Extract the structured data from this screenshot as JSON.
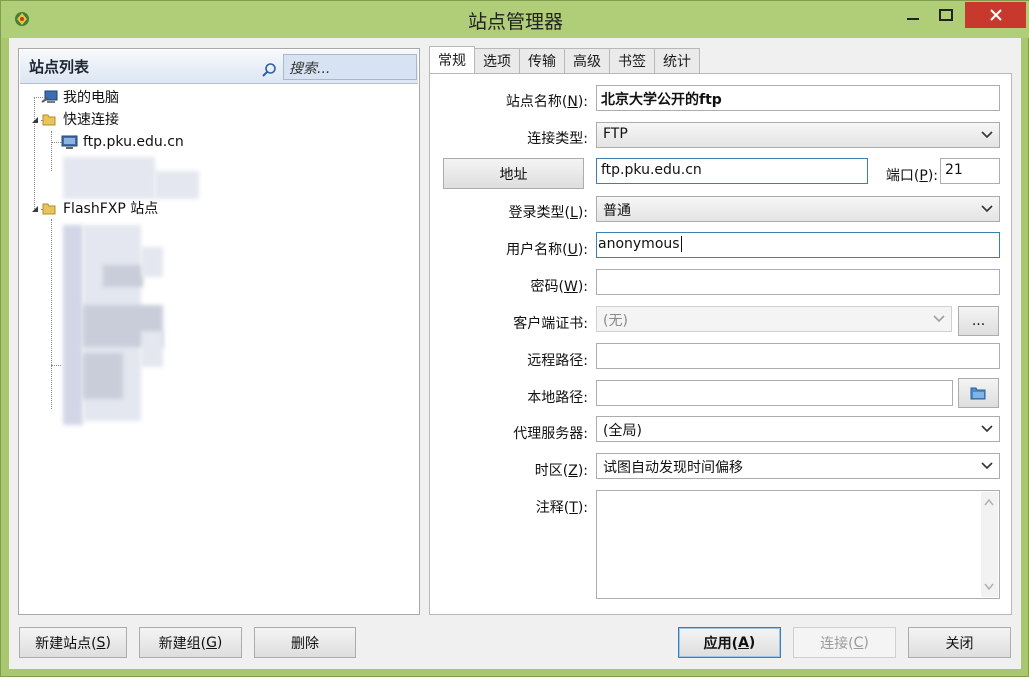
{
  "window": {
    "title": "站点管理器"
  },
  "site_list": {
    "title": "站点列表",
    "search_placeholder": "搜索..."
  },
  "tree": {
    "my_computer": "我的电脑",
    "quick_connect": "快速连接",
    "quick_connect_site": "ftp.pku.edu.cn",
    "flashfxp_sites": "FlashFXP 站点"
  },
  "tabs": [
    "常规",
    "选项",
    "传输",
    "高级",
    "书签",
    "统计"
  ],
  "form": {
    "site_name_label": "站点名称(",
    "site_name_key": "N",
    "site_name": "北京大学公开的ftp",
    "conn_type_label": "连接类型:",
    "conn_type": "FTP",
    "address_button": "地址",
    "address": "ftp.pku.edu.cn",
    "port_label": "端口(",
    "port_key": "P",
    "port": "21",
    "login_type_label": "登录类型(",
    "login_type_key": "L",
    "login_type": "普通",
    "username_label": "用户名称(",
    "username_key": "U",
    "username": "anonymous",
    "password_label": "密码(",
    "password_key": "W",
    "password": "",
    "client_cert_label": "客户端证书:",
    "client_cert": "(无)",
    "browse_button": "...",
    "remote_path_label": "远程路径:",
    "remote_path": "",
    "local_path_label": "本地路径:",
    "local_path": "",
    "proxy_label": "代理服务器:",
    "proxy": "(全局)",
    "timezone_label": "时区(",
    "timezone_key": "Z",
    "timezone": "试图自动发现时间偏移",
    "notes_label": "注释(",
    "notes_key": "T",
    "notes": "",
    "colon_close": "):"
  },
  "buttons": {
    "new_site": "新建站点(",
    "new_site_key": "S",
    "new_group": "新建组(",
    "new_group_key": "G",
    "delete": "删除",
    "apply": "应用(",
    "apply_key": "A",
    "connect": "连接(",
    "connect_key": "C",
    "close": "关闭",
    "paren_close": ")"
  },
  "colors": {
    "titlebar": "#b0cd78",
    "close_button": "#c7392d",
    "focus_border": "#3c7fb1"
  }
}
